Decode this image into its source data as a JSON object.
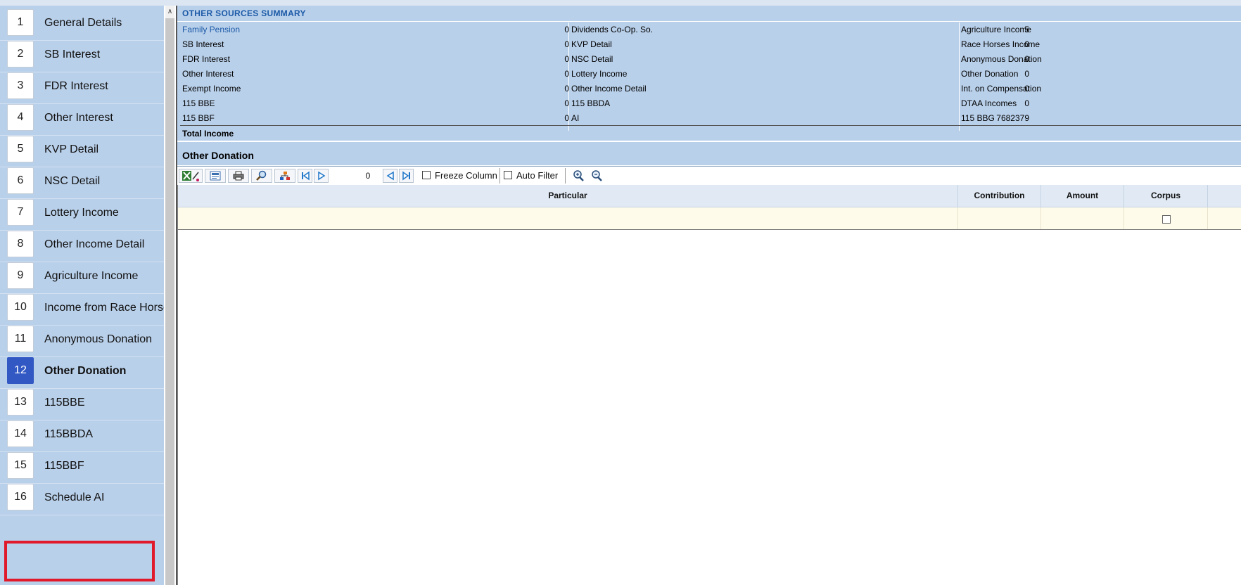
{
  "sidebar": {
    "items": [
      {
        "num": "1",
        "label": "General Details"
      },
      {
        "num": "2",
        "label": "SB Interest"
      },
      {
        "num": "3",
        "label": "FDR Interest"
      },
      {
        "num": "4",
        "label": "Other Interest"
      },
      {
        "num": "5",
        "label": "KVP Detail"
      },
      {
        "num": "6",
        "label": "NSC Detail"
      },
      {
        "num": "7",
        "label": "Lottery Income"
      },
      {
        "num": "8",
        "label": "Other Income Detail"
      },
      {
        "num": "9",
        "label": "Agriculture Income"
      },
      {
        "num": "10",
        "label": "Income from Race Horses"
      },
      {
        "num": "11",
        "label": "Anonymous Donation"
      },
      {
        "num": "12",
        "label": "Other Donation"
      },
      {
        "num": "13",
        "label": "115BBE"
      },
      {
        "num": "14",
        "label": "115BBDA"
      },
      {
        "num": "15",
        "label": "115BBF"
      },
      {
        "num": "16",
        "label": "Schedule AI"
      }
    ],
    "active_index": 11,
    "highlighted_index": 15
  },
  "summary": {
    "title": "OTHER SOURCES SUMMARY",
    "rows": [
      {
        "c1_label": "Family Pension",
        "c1_value": "0",
        "c2_label": "Dividends Co-Op. So.",
        "c2_value": "5",
        "c3_label": "Agriculture Income"
      },
      {
        "c1_label": "SB Interest",
        "c1_value": "0",
        "c2_label": "KVP Detail",
        "c2_value": "0",
        "c3_label": "Race Horses Income"
      },
      {
        "c1_label": "FDR Interest",
        "c1_value": "0",
        "c2_label": "NSC Detail",
        "c2_value": "0",
        "c3_label": "Anonymous Donation"
      },
      {
        "c1_label": "Other Interest",
        "c1_value": "0",
        "c2_label": "Lottery Income",
        "c2_value": "0",
        "c3_label": "Other Donation"
      },
      {
        "c1_label": "Exempt Income",
        "c1_value": "0",
        "c2_label": "Other Income Detail",
        "c2_value": "0",
        "c3_label": "Int. on Compensation"
      },
      {
        "c1_label": "115 BBE",
        "c1_value": "0",
        "c2_label": "115 BBDA",
        "c2_value": "0",
        "c3_label": "DTAA Incomes"
      },
      {
        "c1_label": "115 BBF",
        "c1_value": "0",
        "c2_label": "AI",
        "c2_value": "7682379",
        "c3_label": "115 BBG"
      }
    ],
    "total_label": "Total Income"
  },
  "section": {
    "title": "Other Donation"
  },
  "toolbar": {
    "record_count": "0",
    "freeze_column_label": "Freeze Column",
    "auto_filter_label": "Auto Filter",
    "icons": [
      "excel-export-icon",
      "xml-export-icon",
      "print-icon",
      "find-icon",
      "hierarchy-icon",
      "first-record-icon",
      "next-record-icon",
      "previous-record-icon",
      "last-record-icon",
      "zoom-in-icon",
      "zoom-out-icon"
    ]
  },
  "grid": {
    "columns": [
      "Particular",
      "Contribution",
      "Amount",
      "Corpus"
    ],
    "rows": [
      {
        "particular": "",
        "contribution": "",
        "amount": "",
        "corpus": false
      }
    ]
  },
  "colors": {
    "panel_blue": "#b9d0ea",
    "active_blue": "#3258c4",
    "highlight_red": "#e0192b",
    "link_blue": "#1c5aa7",
    "row_yellow": "#fefbea"
  }
}
